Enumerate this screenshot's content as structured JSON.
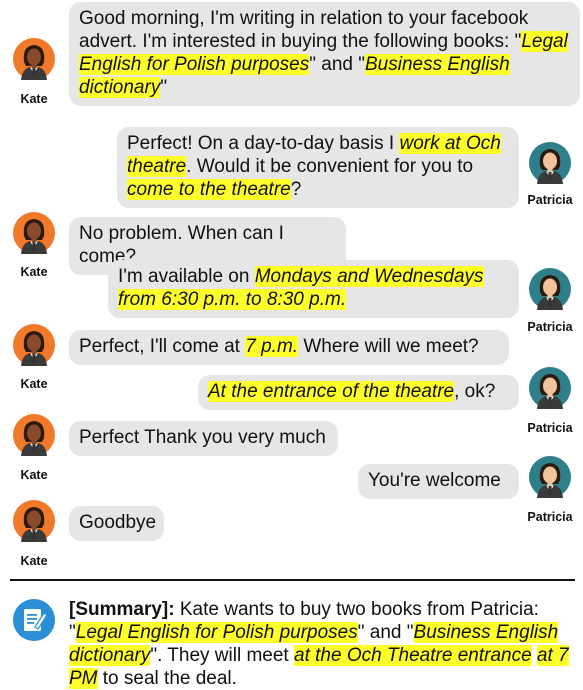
{
  "speakers": {
    "kate": {
      "name": "Kate",
      "skin": "#8a4b2a",
      "hair": "#2b1a10",
      "bg": "#f07a2a",
      "shirt": "#ffffff",
      "tie": "#333333"
    },
    "patricia": {
      "name": "Patricia",
      "skin": "#f2c39a",
      "hair": "#2b1a10",
      "bg": "#2e7f8a",
      "shirt": "#ffffff",
      "tie": "#333333"
    }
  },
  "messages": [
    {
      "speaker": "Kate",
      "segments": [
        {
          "t": "Good morning, I'm writing in relation to your facebook advert. I'm interested in buying the following books: \"",
          "h": false
        },
        {
          "t": "Legal English for Polish purposes",
          "h": true
        },
        {
          "t": "\" and \"",
          "h": false
        },
        {
          "t": "Business English dictionary",
          "h": true
        },
        {
          "t": "\"",
          "h": false
        }
      ]
    },
    {
      "speaker": "Patricia",
      "segments": [
        {
          "t": "Perfect! On a day-to-day basis I ",
          "h": false
        },
        {
          "t": "work at Och theatre",
          "h": true
        },
        {
          "t": ". Would it be convenient for you to ",
          "h": false
        },
        {
          "t": "come to the theatre",
          "h": true
        },
        {
          "t": "?",
          "h": false
        }
      ]
    },
    {
      "speaker": "Kate",
      "segments": [
        {
          "t": "No problem. When can I come?",
          "h": false
        }
      ]
    },
    {
      "speaker": "Patricia",
      "segments": [
        {
          "t": "I'm available on ",
          "h": false
        },
        {
          "t": "Mondays and Wednesdays from 6:30 p.m. to 8:30 p.m.",
          "h": true
        }
      ]
    },
    {
      "speaker": "Kate",
      "segments": [
        {
          "t": "Perfect, I'll come at ",
          "h": false
        },
        {
          "t": "7 p.m.",
          "h": true
        },
        {
          "t": " Where will we meet?",
          "h": false
        }
      ]
    },
    {
      "speaker": "Patricia",
      "segments": [
        {
          "t": "At the entrance of the theatre",
          "h": true
        },
        {
          "t": ", ok?",
          "h": false
        }
      ]
    },
    {
      "speaker": "Kate",
      "segments": [
        {
          "t": "Perfect Thank you very much",
          "h": false
        }
      ]
    },
    {
      "speaker": "Patricia",
      "segments": [
        {
          "t": "You're welcome",
          "h": false
        }
      ]
    },
    {
      "speaker": "Kate",
      "segments": [
        {
          "t": "Goodbye",
          "h": false
        }
      ]
    }
  ],
  "summary": {
    "label": "[Summary]:",
    "icon": "notepad-pen-icon",
    "icon_color": "#2a8fd6",
    "segments": [
      {
        "t": " Kate wants to buy two books from Patricia: \"",
        "h": false
      },
      {
        "t": "Legal English for Polish purposes",
        "h": true
      },
      {
        "t": "\" and \"",
        "h": false
      },
      {
        "t": "Business English dictionary",
        "h": true
      },
      {
        "t": "\". They will meet ",
        "h": false
      },
      {
        "t": "at the Och Theatre entrance",
        "h": true
      },
      {
        "t": " ",
        "h": false
      },
      {
        "t": "at 7 PM",
        "h": true
      },
      {
        "t": " to seal the deal.",
        "h": false
      }
    ]
  },
  "highlight_color": "#ffff2a",
  "bubble_color": "#e6e6e6"
}
